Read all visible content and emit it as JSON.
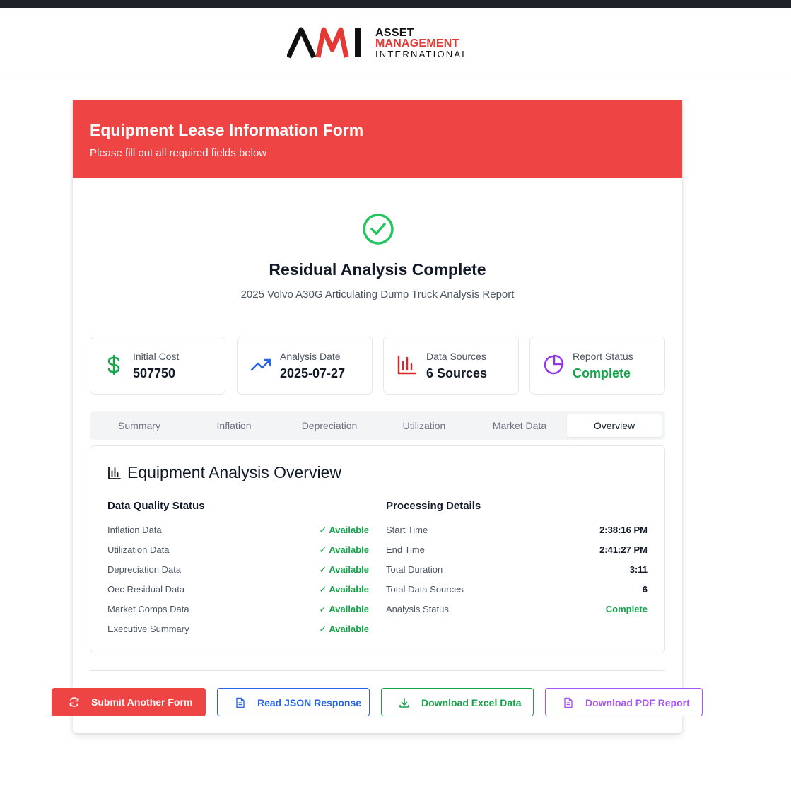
{
  "header": {
    "logo_mark": "AMI",
    "logo_line1": "ASSET",
    "logo_line2": "MANAGEMENT",
    "logo_line3": "INTERNATIONAL"
  },
  "banner": {
    "title": "Equipment Lease Information Form",
    "subtitle": "Please fill out all required fields below"
  },
  "result": {
    "icon": "check-circle-icon",
    "title": "Residual Analysis Complete",
    "subtitle": "2025 Volvo A30G Articulating Dump Truck Analysis Report"
  },
  "stats": [
    {
      "label": "Initial Cost",
      "value": "507750",
      "icon": "dollar-icon",
      "color": "#16a34a"
    },
    {
      "label": "Analysis Date",
      "value": "2025-07-27",
      "icon": "trending-up-icon",
      "color": "#2563eb"
    },
    {
      "label": "Data Sources",
      "value": "6 Sources",
      "icon": "bar-chart-icon",
      "color": "#dc2626"
    },
    {
      "label": "Report Status",
      "value": "Complete",
      "icon": "pie-chart-icon",
      "color": "#9333ea"
    }
  ],
  "tabs": [
    {
      "label": "Summary",
      "active": false
    },
    {
      "label": "Inflation",
      "active": false
    },
    {
      "label": "Depreciation",
      "active": false
    },
    {
      "label": "Utilization",
      "active": false
    },
    {
      "label": "Market Data",
      "active": false
    },
    {
      "label": "Overview",
      "active": true
    }
  ],
  "overview": {
    "title": "Equipment Analysis Overview",
    "data_quality": {
      "heading": "Data Quality Status",
      "rows": [
        {
          "label": "Inflation Data",
          "status": "✓ Available"
        },
        {
          "label": "Utilization Data",
          "status": "✓ Available"
        },
        {
          "label": "Depreciation Data",
          "status": "✓ Available"
        },
        {
          "label": "Oec Residual Data",
          "status": "✓ Available"
        },
        {
          "label": "Market Comps Data",
          "status": "✓ Available"
        },
        {
          "label": "Executive Summary",
          "status": "✓ Available"
        }
      ]
    },
    "processing": {
      "heading": "Processing Details",
      "rows": [
        {
          "label": "Start Time",
          "value": "2:38:16 PM"
        },
        {
          "label": "End Time",
          "value": "2:41:27 PM"
        },
        {
          "label": "Total Duration",
          "value": "3:11"
        },
        {
          "label": "Total Data Sources",
          "value": "6"
        },
        {
          "label": "Analysis Status",
          "value": "Complete"
        }
      ]
    }
  },
  "actions": {
    "submit": "Submit Another Form",
    "json": "Read JSON Response",
    "excel": "Download Excel Data",
    "pdf": "Download PDF Report"
  },
  "colors": {
    "brand_red": "#ef4444",
    "success_green": "#16a34a",
    "info_blue": "#2563eb",
    "purple": "#a855f7"
  }
}
